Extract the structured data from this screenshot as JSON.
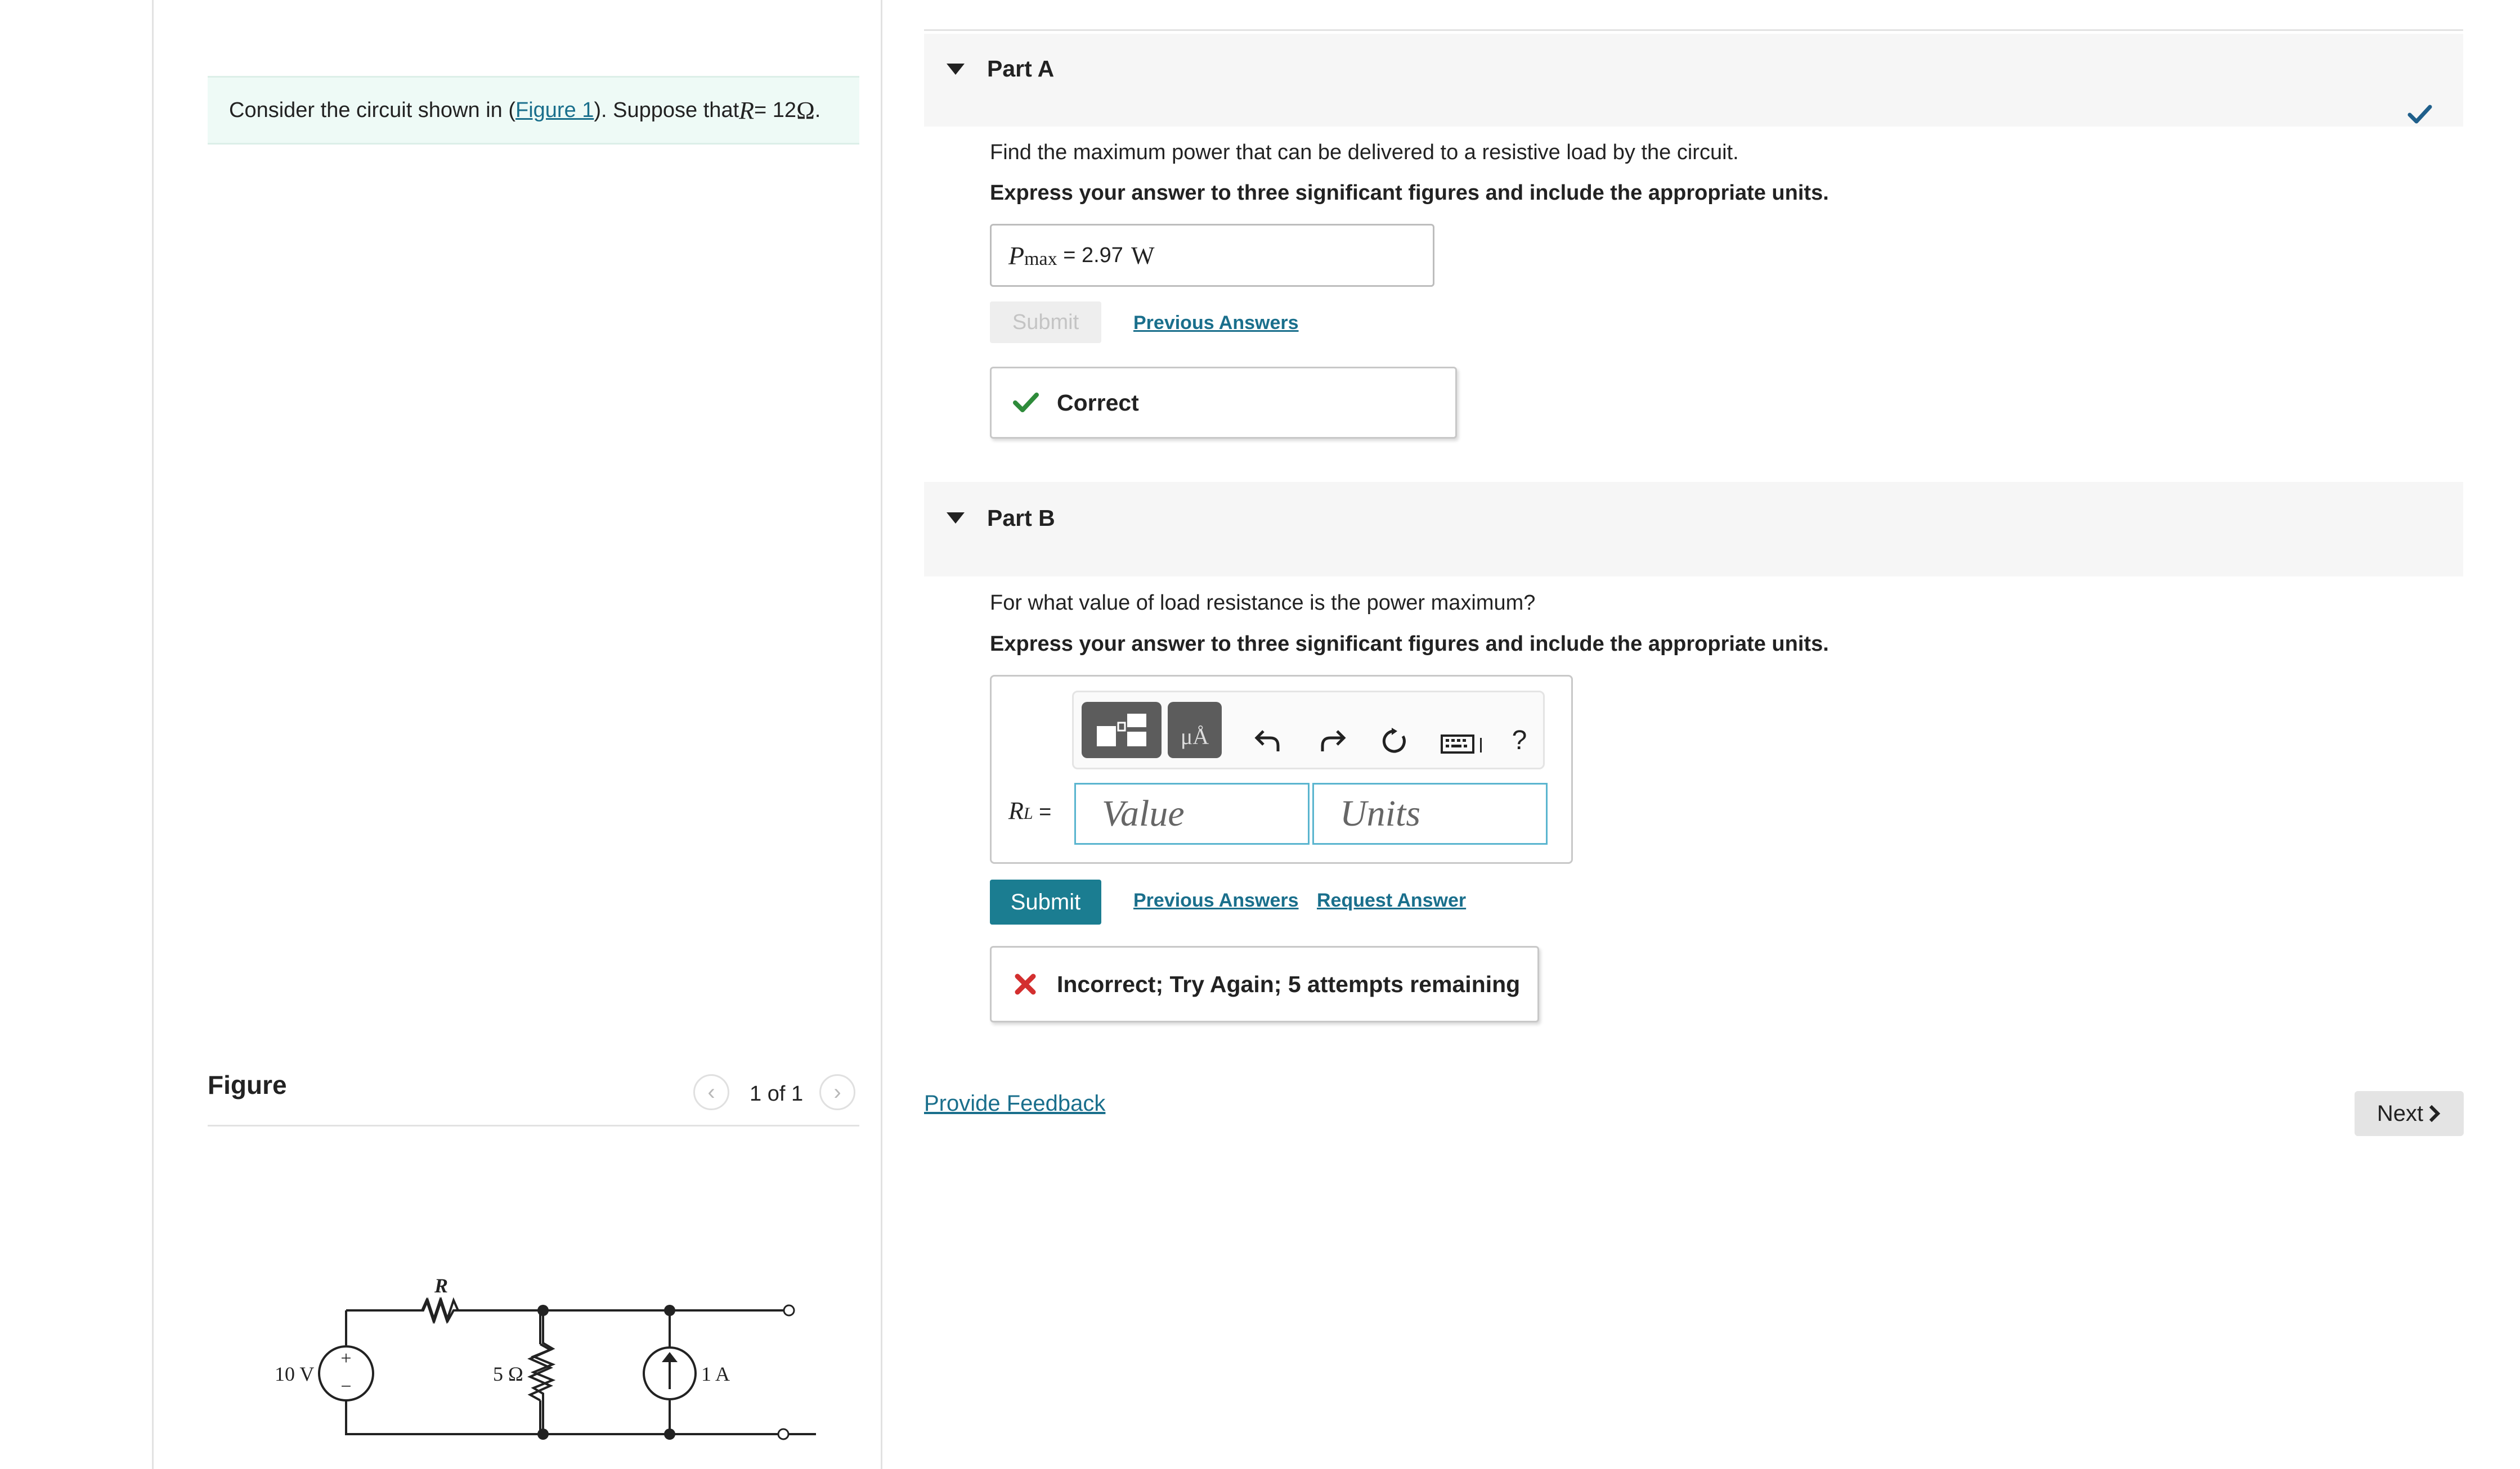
{
  "problem": {
    "prefix": "Consider the circuit shown in (",
    "figure_link": "Figure 1",
    "middle": "). Suppose that ",
    "var": "R",
    "equals": " = 12 ",
    "unit": "Ω",
    "end": "."
  },
  "figure_panel": {
    "title": "Figure",
    "pager": "1 of 1",
    "circuit_labels": {
      "source_voltage": "10 V",
      "plus": "+",
      "minus": "−",
      "resistor_r": "R",
      "resistor_5": "5 Ω",
      "current_source": "1 A"
    }
  },
  "part_a": {
    "title": "Part A",
    "question": "Find the maximum power that can be delivered to a resistive load by the circuit.",
    "instruction": "Express your answer to three significant figures and include the appropriate units.",
    "answer_var": "P",
    "answer_sub": "max",
    "answer_eq": " = ",
    "answer_value": "2.97",
    "answer_unit": "W",
    "submit_label": "Submit",
    "previous_answers": "Previous Answers",
    "feedback": "Correct"
  },
  "part_b": {
    "title": "Part B",
    "question": "For what value of load resistance is the power maximum?",
    "instruction": "Express your answer to three significant figures and include the appropriate units.",
    "toolbar_unit_glyph": "μÅ",
    "help_label": "?",
    "var": "R",
    "var_sub": "L",
    "eq": " =",
    "value_placeholder": "Value",
    "units_placeholder": "Units",
    "submit_label": "Submit",
    "previous_answers": "Previous Answers",
    "request_answer": "Request Answer",
    "feedback": "Incorrect; Try Again; 5 attempts remaining"
  },
  "footer": {
    "provide_feedback": "Provide Feedback",
    "next_label": "Next"
  },
  "colors": {
    "accent": "#1b7d91",
    "link": "#1a6f8c",
    "correct_green": "#2e8b3a",
    "incorrect_red": "#d32f2f",
    "check_blue": "#1f5f8b"
  }
}
